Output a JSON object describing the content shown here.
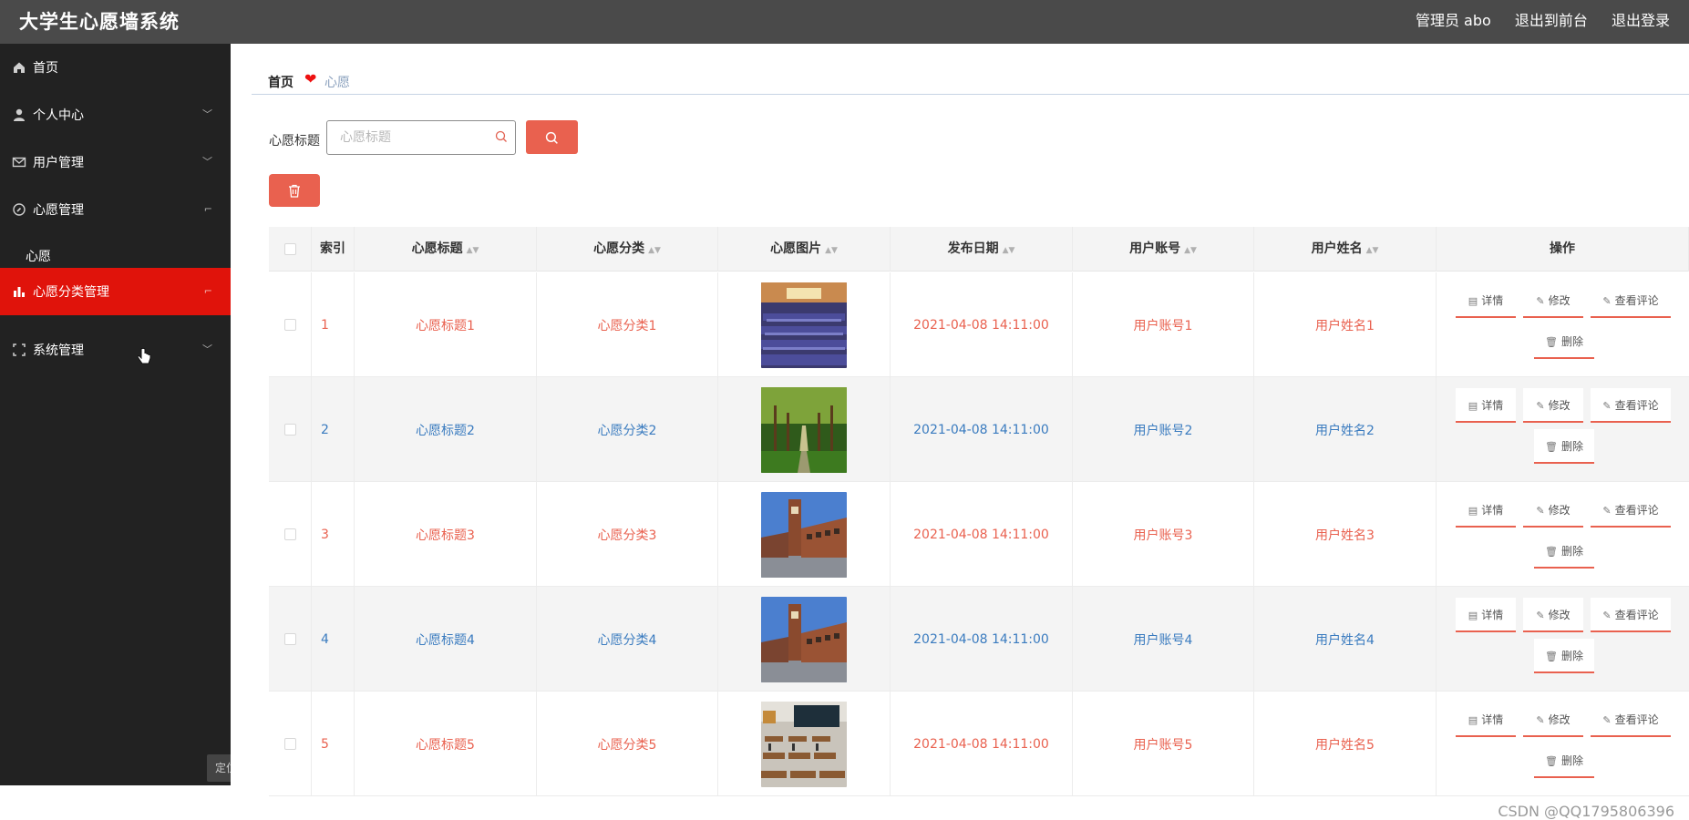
{
  "header": {
    "app_title": "大学生心愿墙系统",
    "admin_label": "管理员 abo",
    "front_link": "退出到前台",
    "logout_link": "退出登录"
  },
  "sidebar": {
    "items": [
      {
        "label": "首页",
        "icon": "home-icon"
      },
      {
        "label": "个人中心",
        "icon": "user-icon",
        "arrow": "﹀"
      },
      {
        "label": "用户管理",
        "icon": "mail-icon",
        "arrow": "﹀"
      },
      {
        "label": "心愿管理",
        "icon": "compass-icon",
        "arrow": "⌐"
      },
      {
        "label": "心愿分类管理",
        "icon": "bar-chart-icon",
        "arrow": "⌐"
      },
      {
        "label": "系统管理",
        "icon": "frame-icon",
        "arrow": "﹀"
      }
    ],
    "sub_item": "心愿",
    "locate_label": "定位",
    "active_color": "#e0130b"
  },
  "breadcrumb": {
    "home": "首页",
    "current": "心愿"
  },
  "search": {
    "label": "心愿标题",
    "placeholder": "心愿标题"
  },
  "table": {
    "columns": [
      "索引",
      "心愿标题",
      "心愿分类",
      "心愿图片",
      "发布日期",
      "用户账号",
      "用户姓名",
      "操作"
    ],
    "actions": {
      "detail": "详情",
      "edit": "修改",
      "comments": "查看评论",
      "delete": "删除"
    },
    "rows": [
      {
        "index": "1",
        "title": "心愿标题1",
        "category": "心愿分类1",
        "image": "auditorium-photo",
        "date": "2021-04-08 14:11:00",
        "account": "用户账号1",
        "name": "用户姓名1"
      },
      {
        "index": "2",
        "title": "心愿标题2",
        "category": "心愿分类2",
        "image": "tree-path-photo",
        "date": "2021-04-08 14:11:00",
        "account": "用户账号2",
        "name": "用户姓名2"
      },
      {
        "index": "3",
        "title": "心愿标题3",
        "category": "心愿分类3",
        "image": "campus-building-photo",
        "date": "2021-04-08 14:11:00",
        "account": "用户账号3",
        "name": "用户姓名3"
      },
      {
        "index": "4",
        "title": "心愿标题4",
        "category": "心愿分类4",
        "image": "campus-building-photo",
        "date": "2021-04-08 14:11:00",
        "account": "用户账号4",
        "name": "用户姓名4"
      },
      {
        "index": "5",
        "title": "心愿标题5",
        "category": "心愿分类5",
        "image": "classroom-photo",
        "date": "2021-04-08 14:11:00",
        "account": "用户账号5",
        "name": "用户姓名5"
      }
    ]
  },
  "colors": {
    "accent": "#e9614f",
    "link_blue": "#3a7bbf",
    "header_bg": "#4a4a4a",
    "sidebar_bg": "#222222"
  },
  "watermark": "CSDN @QQ1795806396"
}
